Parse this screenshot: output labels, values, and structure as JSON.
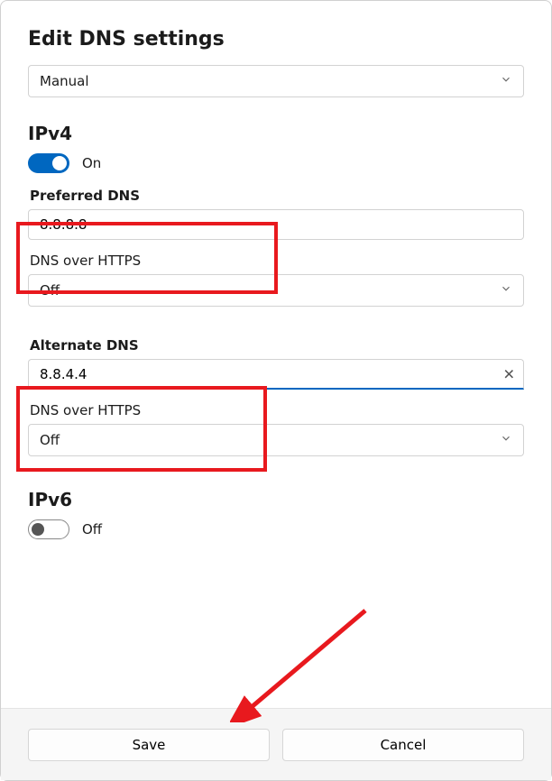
{
  "title": "Edit DNS settings",
  "mode_select": {
    "value": "Manual"
  },
  "ipv4": {
    "heading": "IPv4",
    "toggle_on": true,
    "toggle_label": "On",
    "preferred": {
      "label": "Preferred DNS",
      "value": "8.8.8.8"
    },
    "doh1": {
      "label": "DNS over HTTPS",
      "value": "Off"
    },
    "alternate": {
      "label": "Alternate DNS",
      "value": "8.8.4.4"
    },
    "doh2": {
      "label": "DNS over HTTPS",
      "value": "Off"
    }
  },
  "ipv6": {
    "heading": "IPv6",
    "toggle_on": false,
    "toggle_label": "Off"
  },
  "buttons": {
    "save": "Save",
    "cancel": "Cancel"
  }
}
